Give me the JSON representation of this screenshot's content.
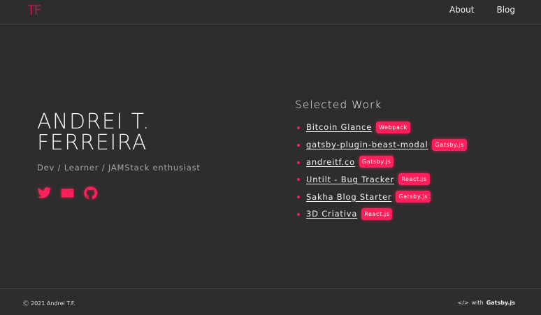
{
  "header": {
    "logo": "TF",
    "nav": [
      "About",
      "Blog"
    ]
  },
  "hero": {
    "name_line1": "ANDREI T.",
    "name_line2": "FERREIRA",
    "tagline": "Dev / Learner / JAMStack enthusiast",
    "socials": [
      "twitter-icon",
      "email-icon",
      "github-icon"
    ]
  },
  "work": {
    "title": "Selected Work",
    "items": [
      {
        "name": "Bitcoin Glance",
        "tag": "Webpack"
      },
      {
        "name": "gatsby-plugin-beast-modal",
        "tag": "Gatsby.js"
      },
      {
        "name": "andreitf.co",
        "tag": "Gatsby.js"
      },
      {
        "name": "Untilt - Bug Tracker",
        "tag": "React.js"
      },
      {
        "name": "Sakha Blog Starter",
        "tag": "Gatsby.js"
      },
      {
        "name": "3D Criativa",
        "tag": "React.js"
      }
    ]
  },
  "footer": {
    "copyright": "2021 Andrei T.F.",
    "built_prefix": "with",
    "built_tool": "Gatsby.js"
  },
  "colors": {
    "accent": "#ff1f5a",
    "background": "#2e2d2e"
  }
}
